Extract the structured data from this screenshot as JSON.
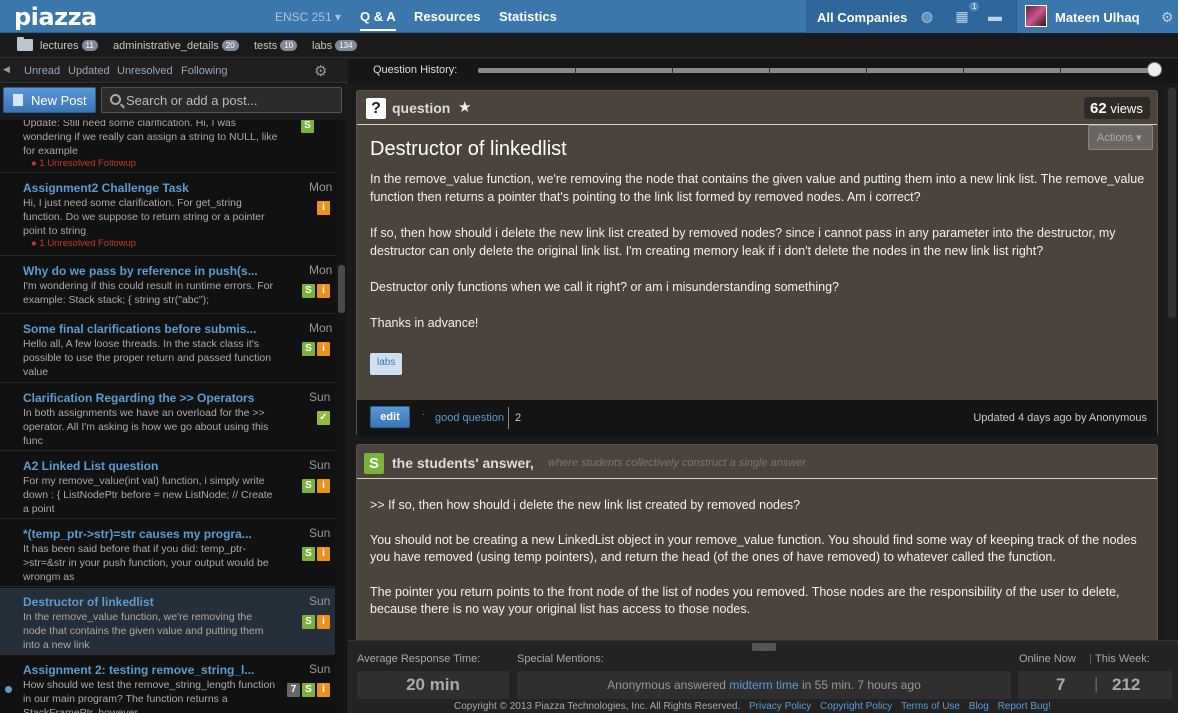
{
  "nav": {
    "logo": "piazza",
    "class_name": "ENSC 251 ▾",
    "qa": "Q & A",
    "resources": "Resources",
    "statistics": "Statistics",
    "companies": "All Companies",
    "notif_count": "1",
    "user_name": "Mateen Ulhaq"
  },
  "folders": [
    {
      "name": "lectures",
      "count": "11"
    },
    {
      "name": "administrative_details",
      "count": "20"
    },
    {
      "name": "tests",
      "count": "10"
    },
    {
      "name": "labs",
      "count": "134"
    }
  ],
  "filters": [
    "Unread",
    "Updated",
    "Unresolved",
    "Following"
  ],
  "new_post": "New Post",
  "search_placeholder": "Search or add a post...",
  "posts": [
    {
      "title": "",
      "date": "",
      "snippet": "Update: Still need some clarification. Hi, I was wondering if we really can assign a string to NULL, like for example",
      "followup": "1 Unresolved Followup",
      "badges": [
        "S"
      ]
    },
    {
      "title": "Assignment2 Challenge Task",
      "date": "Mon",
      "snippet": "Hi, I just need some clarification. For get_string function. Do we suppose to return string or a pointer point to string",
      "followup": "1 Unresolved Followup",
      "badges": [
        "i"
      ]
    },
    {
      "title": "Why do we pass by reference in push(s...",
      "date": "Mon",
      "snippet": "I'm wondering if this could result in runtime errors. For example: Stack stack; {     string str(\"abc\");",
      "followup": "",
      "badges": [
        "S",
        "i"
      ]
    },
    {
      "title": "Some final clarifications before submis...",
      "date": "Mon",
      "snippet": "Hello all, A few loose threads. In the stack class it's possible to use the proper return and passed function value",
      "followup": "",
      "badges": [
        "S",
        "i"
      ]
    },
    {
      "title": "Clarification Regarding the >> Operators",
      "date": "Sun",
      "snippet": "In both assignments we have an overload for the >> operator. All I'm asking is how we go about using this func",
      "followup": "",
      "badges": [
        "ok"
      ]
    },
    {
      "title": "A2 Linked List question",
      "date": "Sun",
      "snippet": "For my remove_value(int val) function, i simply write down : { ListNodePtr before = new ListNode; // Create a point",
      "followup": "",
      "badges": [
        "S",
        "i"
      ]
    },
    {
      "title": "*(temp_ptr->str)=str causes my progra...",
      "date": "Sun",
      "snippet": "It has been said before that if you did: temp_ptr->str=&str in your push function, your output would be wrongm as",
      "followup": "",
      "badges": [
        "S",
        "i"
      ]
    },
    {
      "title": "Destructor of linkedlist",
      "date": "Sun",
      "snippet": "In the remove_value function, we're removing the node that contains the given value and putting them into a new link",
      "followup": "",
      "badges": [
        "S",
        "i"
      ]
    },
    {
      "title": "Assignment 2: testing remove_string_l...",
      "date": "Sun",
      "snippet": "How should we test the remove_string_length function in our main program? The function returns a StackFramePtr, however",
      "followup": "",
      "badges": [
        "7",
        "S",
        "i"
      ]
    }
  ],
  "history_label": "Question History:",
  "question": {
    "type_label": "question",
    "views_num": "62",
    "views_label": "views",
    "actions": "Actions ▾",
    "title": "Destructor of linkedlist",
    "body": [
      "In the remove_value function, we're removing the node that contains the given value and putting them into a new link list. The remove_value function then returns a pointer that's pointing to the link list formed by removed nodes. Am i correct?",
      "If so, then how should i delete the new link list created by removed nodes? since i cannot pass in any parameter into the destructor, my destructor can only delete the original link list. I'm creating memory leak if i don't delete the nodes in the new link list right?",
      "Destructor only functions when we call it right? or am i misunderstanding something?",
      "Thanks in advance!"
    ],
    "tag": "labs",
    "edit": "edit",
    "good_question": "good question",
    "good_count": "2",
    "updated": "Updated 4 days ago by Anonymous"
  },
  "answer": {
    "type_label": "the students' answer,",
    "subtitle": "where students collectively construct a single answer",
    "body": [
      ">> If so, then how should i delete the new link list created by removed nodes?",
      "You should not be creating a new LinkedList object in your remove_value function. You should find some way of keeping track of the nodes you have removed (using temp pointers), and return the head (of the ones of have removed) to whatever called the function.",
      "The pointer you return points to the front node of the list of nodes you removed. Those nodes are the responsibility of the user to delete, because there is no way your original list has access to those nodes."
    ]
  },
  "stats": {
    "resp_label": "Average Response Time:",
    "resp_value": "20 min",
    "mention_label": "Special Mentions:",
    "mention_pre": "Anonymous answered ",
    "mention_link": "midterm time",
    "mention_post": " in 55 min. 7 hours ago",
    "online_label": "Online Now",
    "week_label": "This Week:",
    "online_value": "7",
    "week_value": "212"
  },
  "footer": {
    "copyright": "Copyright © 2013 Piazza Technologies, Inc. All Rights Reserved.",
    "links": [
      "Privacy Policy",
      "Copyright Policy",
      "Terms of Use",
      "Blog",
      "Report Bug!"
    ]
  }
}
